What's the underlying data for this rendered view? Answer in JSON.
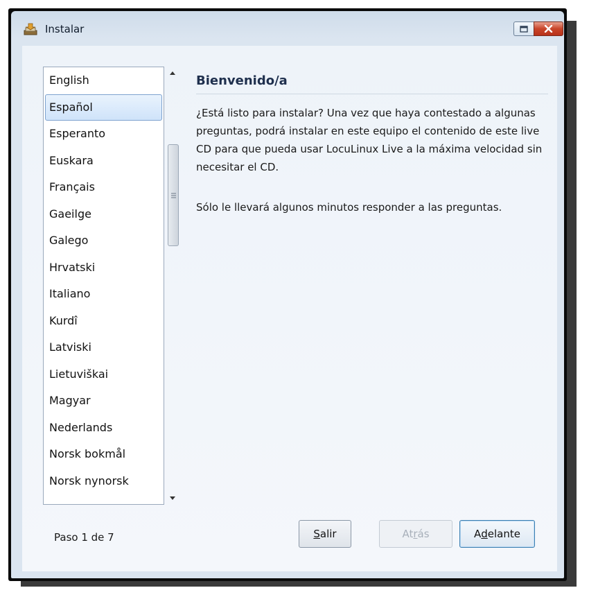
{
  "window": {
    "title": "Instalar"
  },
  "languages": [
    {
      "label": "English"
    },
    {
      "label": "Español",
      "selected": true
    },
    {
      "label": "Esperanto"
    },
    {
      "label": "Euskara"
    },
    {
      "label": "Français"
    },
    {
      "label": "Gaeilge"
    },
    {
      "label": "Galego"
    },
    {
      "label": "Hrvatski"
    },
    {
      "label": "Italiano"
    },
    {
      "label": "Kurdî"
    },
    {
      "label": "Latviski"
    },
    {
      "label": "Lietuviškai"
    },
    {
      "label": "Magyar"
    },
    {
      "label": "Nederlands"
    },
    {
      "label": "Norsk bokmål"
    },
    {
      "label": "Norsk nynorsk"
    }
  ],
  "content": {
    "heading": "Bienvenido/a",
    "paragraph1": "¿Está listo para instalar? Una vez que haya contestado a algunas preguntas, podrá instalar en este equipo el contenido de este live CD para que pueda usar LocuLinux Live a la máxima velocidad sin necesitar el CD.",
    "paragraph2": "Sólo le llevará algunos minutos responder a las preguntas."
  },
  "footer": {
    "step": "Paso 1 de 7",
    "quit_prefix": "",
    "quit_mnemonic": "S",
    "quit_rest": "alir",
    "back_prefix": "At",
    "back_mnemonic": "r",
    "back_rest": "ás",
    "next_prefix": "A",
    "next_mnemonic": "d",
    "next_rest": "elante"
  },
  "icons": {
    "app": "installer-icon",
    "maximize": "maximize-icon",
    "close": "close-icon",
    "scroll_up": "scroll-up-arrow-icon",
    "scroll_down": "scroll-down-arrow-icon",
    "grip": "scroll-grip-icon"
  },
  "colors": {
    "selection": "#cfe3fa",
    "heading": "#1e2f4d",
    "close_button": "#c9452a",
    "default_button_border": "#3c7fb1"
  }
}
